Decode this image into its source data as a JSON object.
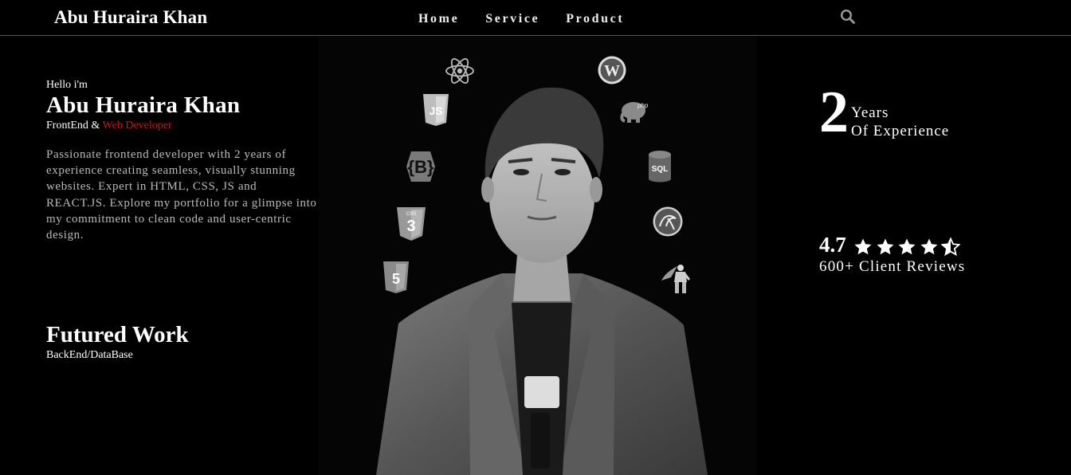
{
  "header": {
    "brand": "Abu Huraira Khan",
    "nav": [
      "Home",
      "Service",
      "Product"
    ],
    "search_icon": "search-icon"
  },
  "intro": {
    "greeting": "Hello i'm",
    "name": "Abu Huraira Khan",
    "role_prefix": "FrontEnd &",
    "role_accent": "Web Developer",
    "bio": "Passionate frontend developer with 2 years of experience creating seamless, visually stunning websites. Expert in HTML, CSS, JS and REACT.JS. Explore my portfolio for a glimpse into my commitment to clean code and user-centric design."
  },
  "featured": {
    "title": "Futured Work",
    "subtitle": "BackEnd/DataBase"
  },
  "stats": {
    "years": "2",
    "years_line1": "Years",
    "years_line2": "Of Experience",
    "rating": "4.7",
    "stars_value": 4.5,
    "reviews": "600+ Client Reviews"
  },
  "tech_icons": {
    "react": "react-icon",
    "javascript": "javascript-icon",
    "bootstrap": "bootstrap-icon",
    "css3": "css3-icon",
    "html5": "html5-icon",
    "wordpress": "wordpress-icon",
    "php": "php-icon",
    "sql": "sql-icon",
    "mysql": "mysql-icon",
    "hero": "superhero-icon"
  },
  "colors": {
    "background": "#000000",
    "accent": "#c01818",
    "text": "#ffffff",
    "muted": "#bbbbbb"
  }
}
